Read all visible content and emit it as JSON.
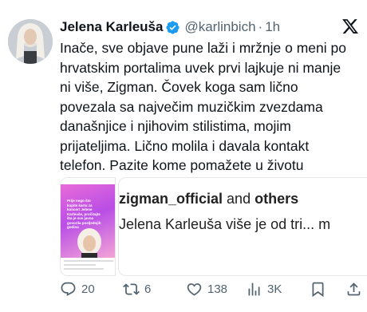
{
  "author": {
    "name": "Jelena Karleuša",
    "handle": "@karlinbich",
    "separator": "·",
    "time": "1h"
  },
  "tweet": {
    "lines": [
      "Inače, sve objave pune laži i mržnje o meni po",
      "hrvatskim portalima uvek prvi lajkuje ni manje",
      "ni više, Zigman. Čovek koga sam lično",
      "povezala sa največim muzičkim zvezdama",
      "današnjice i njihovim stilistima, mojim",
      "prijateljima. Lično molila i davala kontakt",
      "telefon. Pazite kome pomažete u životu"
    ]
  },
  "media": {
    "left_caption": "Prije nego što kupite kartu za koncert Jelene Karleuše, pročitajte šta je sve javno govorila posljednjih godina",
    "right_top_user": "zigman_official",
    "right_top_and": "and",
    "right_top_others": "others",
    "right_bottom_text": "Jelena Karleuša više je od tri... m"
  },
  "actions": {
    "replies": "20",
    "reposts": "6",
    "likes": "138",
    "views": "3K"
  },
  "icons": {
    "verified": "verified-badge-icon",
    "x_logo": "x-logo-icon",
    "reply": "reply-icon",
    "repost": "repost-icon",
    "like": "heart-icon",
    "views": "views-icon",
    "bookmark": "bookmark-icon",
    "share": "share-icon"
  },
  "colors": {
    "verified": "#1d9bf0",
    "muted": "#536471",
    "text": "#0f1419"
  }
}
